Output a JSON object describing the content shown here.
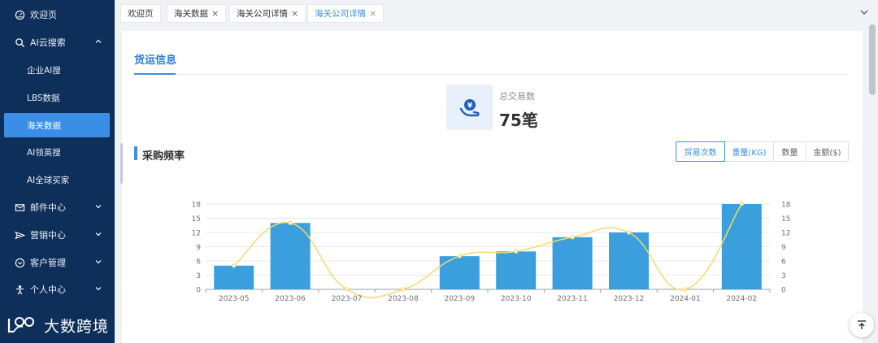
{
  "sidebar": {
    "items": [
      {
        "label": "欢迎页",
        "icon": "dashboard-icon"
      },
      {
        "label": "AI云搜索",
        "icon": "search-icon",
        "expanded": true,
        "children": [
          {
            "label": "企业AI搜"
          },
          {
            "label": "LBS数据"
          },
          {
            "label": "海关数据",
            "active": true
          },
          {
            "label": "AI领英搜"
          },
          {
            "label": "AI全球买家"
          }
        ]
      },
      {
        "label": "邮件中心",
        "icon": "mail-icon"
      },
      {
        "label": "营销中心",
        "icon": "send-icon"
      },
      {
        "label": "客户管理",
        "icon": "customer-icon"
      },
      {
        "label": "个人中心",
        "icon": "person-icon"
      }
    ],
    "logo_text": "大数跨境"
  },
  "tabs": [
    {
      "label": "欢迎页",
      "closable": false
    },
    {
      "label": "海关数据",
      "closable": true
    },
    {
      "label": "海关公司详情",
      "closable": true
    },
    {
      "label": "海关公司详情",
      "closable": true,
      "active": true
    }
  ],
  "section": {
    "title": "货运信息"
  },
  "stat": {
    "label": "总交易数",
    "value": "75笔"
  },
  "frequency": {
    "title": "采购频率",
    "buttons": [
      "贸易次数",
      "重量(KG)",
      "数量",
      "金额($)"
    ],
    "active_button": "贸易次数"
  },
  "colors": {
    "accent": "#3a8ee6",
    "sidebar": "#0e2f5a",
    "bar": "#3a9fdc",
    "line": "#f7d96b"
  },
  "chart_data": {
    "type": "bar",
    "categories": [
      "2023-05",
      "2023-06",
      "2023-07",
      "2023-08",
      "2023-09",
      "2023-10",
      "2023-11",
      "2023-12",
      "2024-01",
      "2024-02"
    ],
    "series": [
      {
        "type": "bar",
        "values": [
          5,
          14,
          0,
          0,
          7,
          8,
          11,
          12,
          0,
          18
        ]
      },
      {
        "type": "line",
        "smooth": true,
        "values": [
          5,
          14,
          0,
          0,
          7,
          8,
          11,
          12,
          0,
          18
        ]
      }
    ],
    "yticks": [
      "0",
      "3",
      "6",
      "9",
      "12",
      "15",
      "18"
    ],
    "ylim": [
      0,
      18
    ],
    "grid": true,
    "dual_axis": true
  }
}
